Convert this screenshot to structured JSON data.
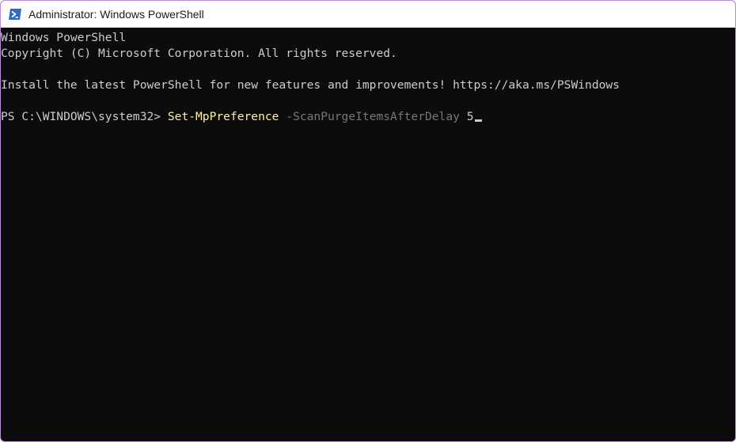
{
  "window": {
    "title": "Administrator: Windows PowerShell",
    "icon": "powershell-icon"
  },
  "console": {
    "lines": [
      "Windows PowerShell",
      "Copyright (C) Microsoft Corporation. All rights reserved.",
      "",
      "Install the latest PowerShell for new features and improvements! https://aka.ms/PSWindows",
      ""
    ],
    "prompt": "PS C:\\WINDOWS\\system32> ",
    "command": {
      "cmdlet": "Set-MpPreference",
      "parameter": "-ScanPurgeItemsAfterDelay",
      "value": "5"
    }
  },
  "colors": {
    "background": "#0c0c0c",
    "text": "#cccccc",
    "cmdlet": "#f9f1a5",
    "parameter": "#767676",
    "border": "#b98fd6"
  }
}
